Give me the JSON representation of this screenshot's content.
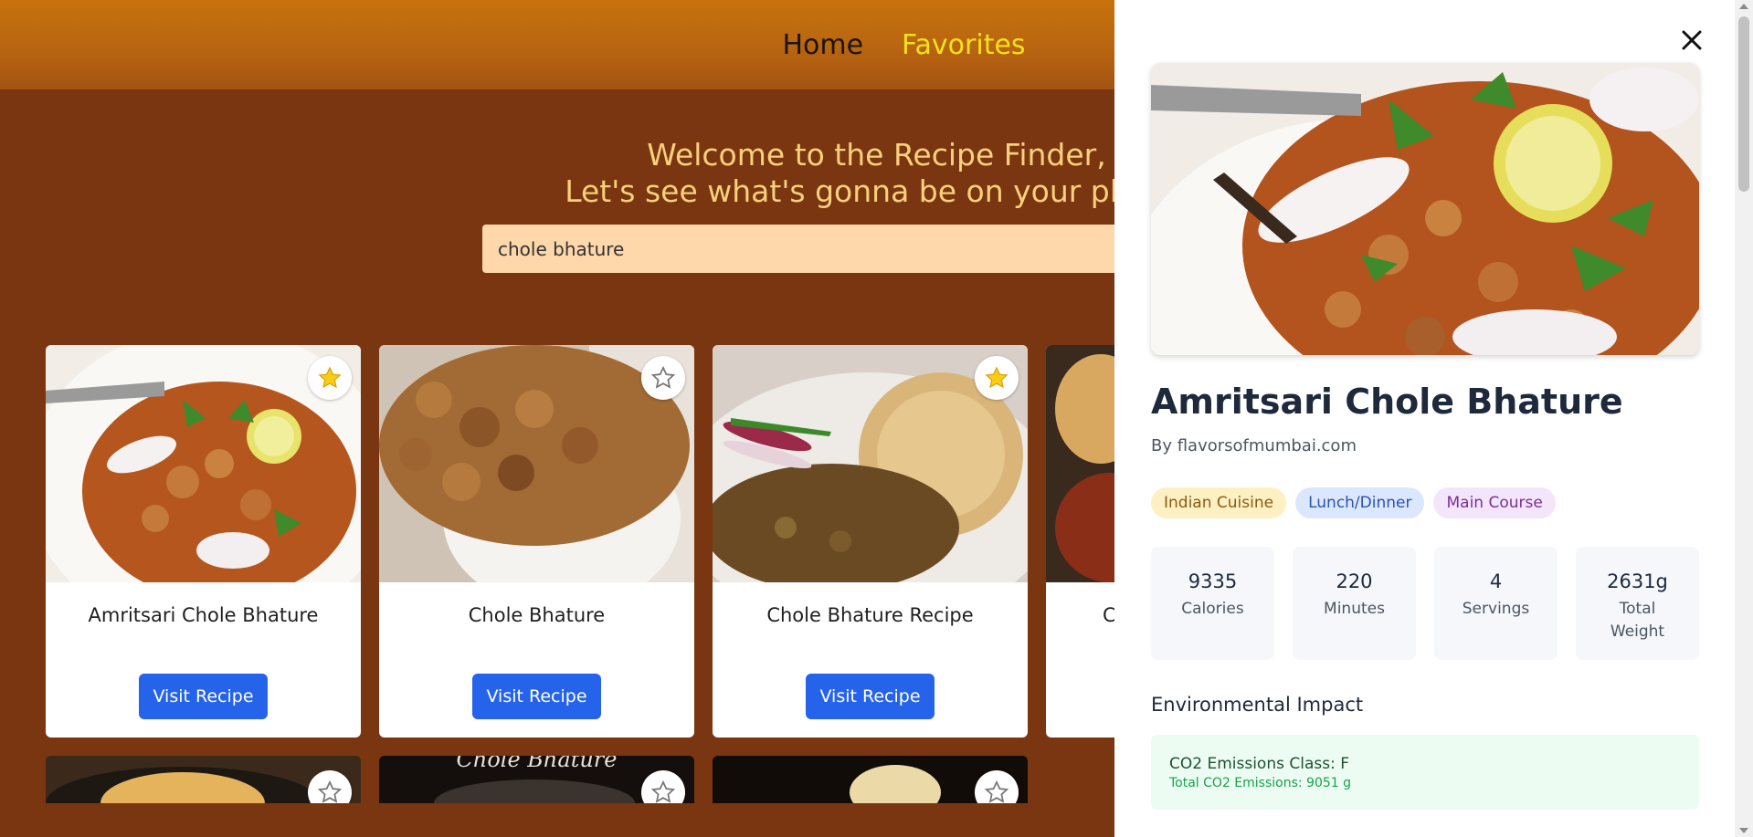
{
  "nav": {
    "home": "Home",
    "favorites": "Favorites"
  },
  "hero": {
    "line1": "Welcome to the Recipe Finder,",
    "line2": "Let's see what's gonna be on your plate t"
  },
  "search": {
    "value": "chole bhature"
  },
  "cards": [
    {
      "title": "Amritsari Chole Bhature",
      "button": "Visit Recipe",
      "favorite": true
    },
    {
      "title": "Chole Bhature",
      "button": "Visit Recipe",
      "favorite": false
    },
    {
      "title": "Chole Bhature Recipe",
      "button": "Visit Recipe",
      "favorite": true
    },
    {
      "title": "C",
      "button": "",
      "favorite": false
    }
  ],
  "second_row_card_text": "Chole Bhature",
  "drawer": {
    "title": "Amritsari Chole Bhature",
    "byline": "By flavorsofmumbai.com",
    "tags": [
      "Indian Cuisine",
      "Lunch/Dinner",
      "Main Course"
    ],
    "stats": [
      {
        "value": "9335",
        "label": "Calories"
      },
      {
        "value": "220",
        "label": "Minutes"
      },
      {
        "value": "4",
        "label": "Servings"
      },
      {
        "value": "2631g",
        "label": "Total Weight"
      }
    ],
    "env_heading": "Environmental Impact",
    "env_class": "CO2 Emissions Class: F",
    "env_total": "Total CO2 Emissions: 9051 g"
  },
  "colors": {
    "page_bg": "#7a3610",
    "accent_button": "#2563eb",
    "favorites_link": "#f5e11b",
    "hero_text": "#f8d07c",
    "star_active": "#facc15"
  }
}
